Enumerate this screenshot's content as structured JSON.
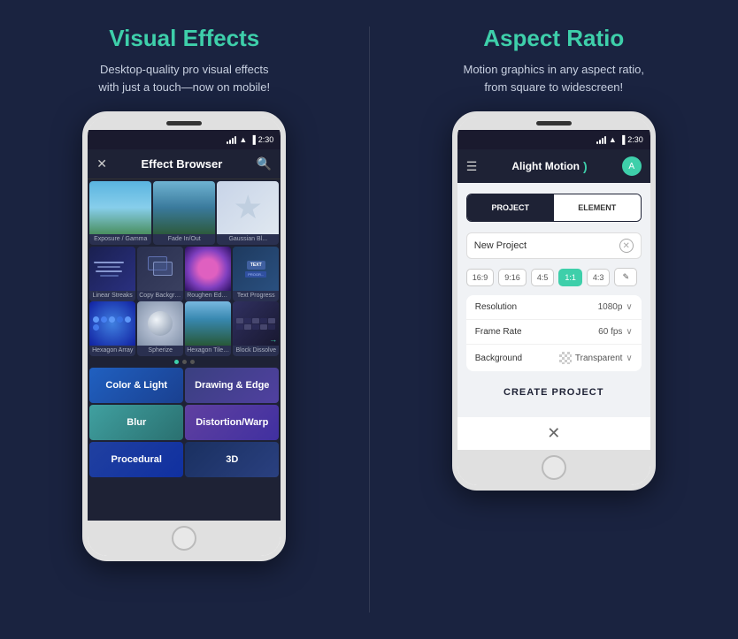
{
  "left_panel": {
    "title": "Visual Effects",
    "subtitle": "Desktop-quality pro visual effects\nwith just a touch—now on mobile!",
    "phone": {
      "status_bar": {
        "time": "2:30"
      },
      "header": {
        "title": "Effect Browser"
      },
      "effects_row1": [
        {
          "label": "Exposure / Gamma",
          "thumb": "sky"
        },
        {
          "label": "Fade In/Out",
          "thumb": "lake"
        },
        {
          "label": "Gaussian Bl...",
          "thumb": "star"
        }
      ],
      "effects_row2": [
        {
          "label": "Linear Streaks",
          "thumb": "streaks"
        },
        {
          "label": "Copy Background",
          "thumb": "copy"
        },
        {
          "label": "Roughen Edges",
          "thumb": "roughen"
        },
        {
          "label": "Text Progress",
          "thumb": "text"
        }
      ],
      "effects_row3": [
        {
          "label": "Hexagon Array",
          "thumb": "hexarray"
        },
        {
          "label": "Spherize",
          "thumb": "sphere"
        },
        {
          "label": "Hexagon Tile Shift",
          "thumb": "hextile"
        },
        {
          "label": "Block Dissolve",
          "thumb": "block"
        }
      ],
      "categories": [
        {
          "label": "Color & Light",
          "style": "cat-color"
        },
        {
          "label": "Drawing & Edge",
          "style": "cat-drawing"
        },
        {
          "label": "Blur",
          "style": "cat-blur"
        },
        {
          "label": "Distortion/Warp",
          "style": "cat-distort"
        },
        {
          "label": "Procedural",
          "style": "cat-proc"
        },
        {
          "label": "3D",
          "style": "cat-3d"
        }
      ]
    }
  },
  "right_panel": {
    "title": "Aspect Ratio",
    "subtitle": "Motion graphics in any aspect ratio,\nfrom square to widescreen!",
    "phone": {
      "status_bar": {
        "time": "2:30"
      },
      "header": {
        "app_name": "Alight Motion"
      },
      "tabs": [
        {
          "label": "PROJECT",
          "active": true
        },
        {
          "label": "ELEMENT",
          "active": false
        }
      ],
      "project_name": "New Project",
      "aspect_ratios": [
        {
          "label": "16:9",
          "active": false
        },
        {
          "label": "9:16",
          "active": false
        },
        {
          "label": "4:5",
          "active": false
        },
        {
          "label": "1:1",
          "active": true
        },
        {
          "label": "4:3",
          "active": false
        },
        {
          "label": "✎",
          "active": false,
          "type": "edit"
        }
      ],
      "settings": [
        {
          "label": "Resolution",
          "value": "1080p"
        },
        {
          "label": "Frame Rate",
          "value": "60 fps"
        },
        {
          "label": "Background",
          "value": "Transparent",
          "has_icon": true
        }
      ],
      "create_button": "CREATE PROJECT",
      "close_label": "✕"
    }
  }
}
